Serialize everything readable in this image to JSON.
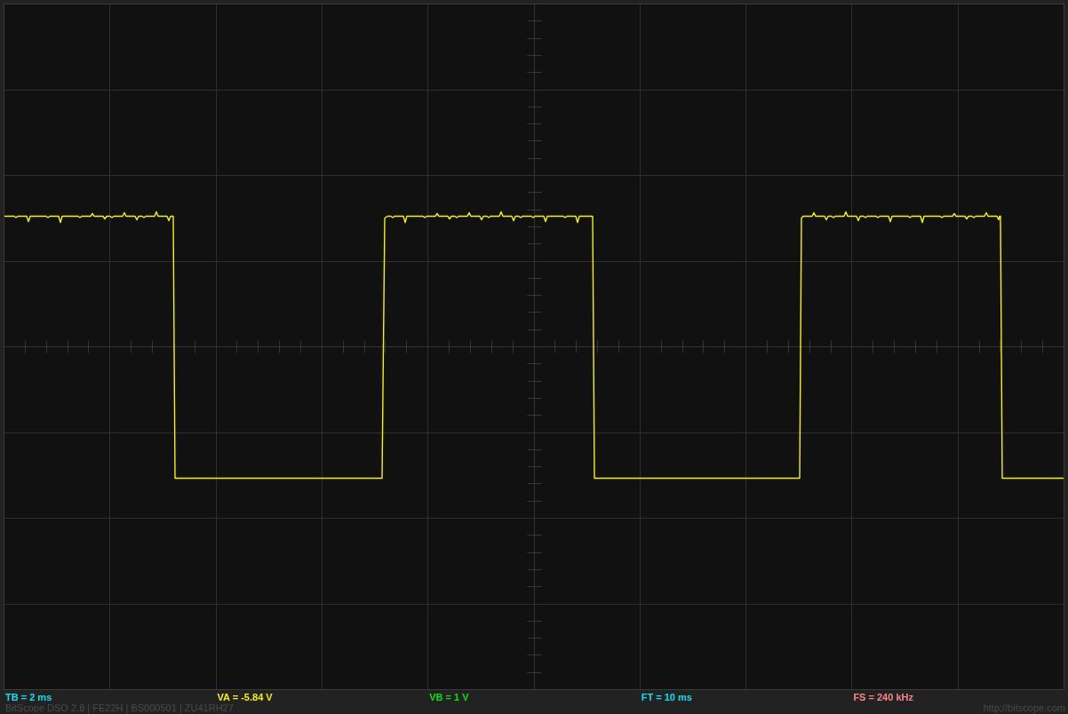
{
  "readouts": [
    {
      "label": "TB = 2 ms",
      "color": "#00e5f2"
    },
    {
      "label": "VA = -5.84 V",
      "color": "#f2f200"
    },
    {
      "label": "VB = 1 V",
      "color": "#00e600"
    },
    {
      "label": "FT = 10 ms",
      "color": "#00e5f2"
    },
    {
      "label": "FS = 240 kHz",
      "color": "#ff8585"
    }
  ],
  "device_info": "BitScope DSO 2.8 | FE22H | BS000501 | ZU41RH27",
  "website": "http://bitscope.com"
}
